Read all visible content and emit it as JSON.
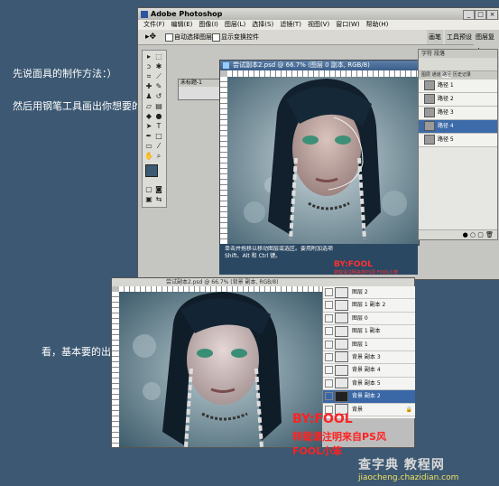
{
  "colors": {
    "background": "#3c5872",
    "accent_red": "#ff2222",
    "selection": "#3d6aa8"
  },
  "captions": {
    "line1": "先说面具的制作方法：）",
    "line2": "然后用钢笔工具画出你想要的面具的形状.",
    "line3": "看，基本要的出来了"
  },
  "photoshop": {
    "title": "Adobe Photoshop",
    "menu": [
      "文件(F)",
      "编辑(E)",
      "图像(I)",
      "图层(L)",
      "选择(S)",
      "滤镜(T)",
      "视图(V)",
      "窗口(W)",
      "帮助(H)"
    ],
    "options": {
      "auto_select": "自动选择图层",
      "show_bounds": "显示变换控件"
    },
    "right_tabs": [
      "画笔",
      "工具预设",
      "图层复合"
    ],
    "small_doc_title": "未标题-1",
    "doc_title": "尝试副本2.psd @ 66.7% (图层 0 副本, RGB/8)",
    "palette_tabs": [
      "字符",
      "段落"
    ],
    "palette_tabs2": [
      "图层",
      "通道",
      "路径",
      "历史记录"
    ],
    "paths": [
      {
        "name": "路径 1",
        "selected": false
      },
      {
        "name": "路径 2",
        "selected": false
      },
      {
        "name": "路径 3",
        "selected": false
      },
      {
        "name": "路径 4",
        "selected": true
      },
      {
        "name": "路径 5",
        "selected": false
      }
    ],
    "status_lines": [
      "单击并拖移以移动图层或选区。要用附加选项，使用",
      "Shift、Alt 和 Ctrl 键。"
    ],
    "by_small": "BY:FOOL",
    "repost_small": "转载请注明来自PS风 FOOL小笨"
  },
  "bottom_window": {
    "title": "尝试副本2.psd @ 66.7% (背景 副本, RGB/8)",
    "layers": [
      {
        "name": "图层 2",
        "selected": false
      },
      {
        "name": "图层 1 副本 2",
        "selected": false
      },
      {
        "name": "图层 0",
        "selected": false
      },
      {
        "name": "图层 1 副本",
        "selected": false
      },
      {
        "name": "图层 1",
        "selected": false
      },
      {
        "name": "背景 副本 3",
        "selected": false
      },
      {
        "name": "背景 副本 4",
        "selected": false
      },
      {
        "name": "背景 副本 5",
        "selected": false
      },
      {
        "name": "背景 副本 2",
        "selected": true
      },
      {
        "name": "背景",
        "selected": false
      }
    ],
    "by": "BY:FOOL",
    "repost": "转载请注明来自PS风 FOOL小笨"
  },
  "watermark": {
    "logo": "查字典 教程网",
    "url": "jiaocheng.chazidian.com"
  }
}
